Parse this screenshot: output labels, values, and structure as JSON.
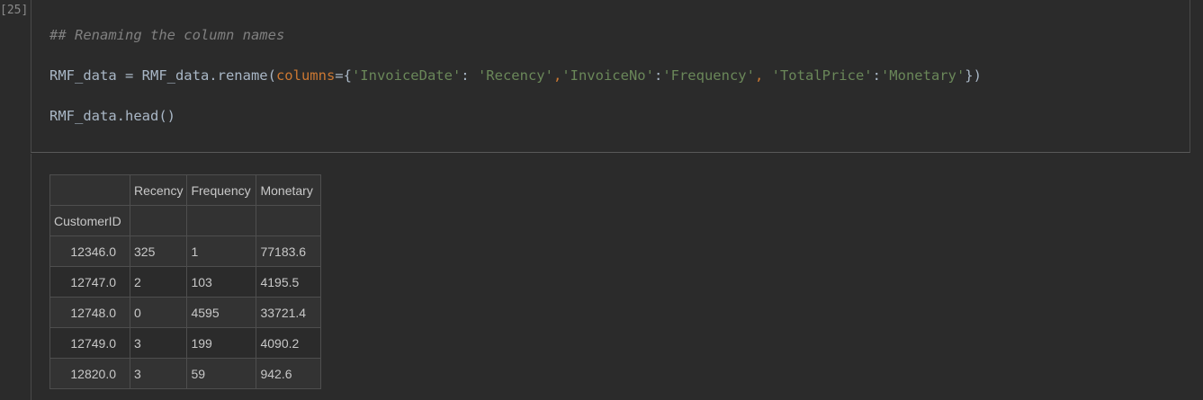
{
  "cell": {
    "execution_count": "[25]",
    "code": {
      "comment": "## Renaming the column names",
      "line2": {
        "lhs": "RMF_data = RMF_data.rename(",
        "kwarg": "columns",
        "eq_brace": "={",
        "k1": "'InvoiceDate'",
        "sep1": ": ",
        "v1": "'Recency'",
        "comma1": ",",
        "k2": "'InvoiceNo'",
        "sep2": ":",
        "v2": "'Frequency'",
        "comma2": ", ",
        "k3": "'TotalPrice'",
        "sep3": ":",
        "v3": "'Monetary'",
        "close": "})"
      },
      "line3": "RMF_data.head()"
    }
  },
  "output": {
    "columns": [
      "Recency",
      "Frequency",
      "Monetary"
    ],
    "index_name": "CustomerID",
    "rows": [
      {
        "index": "12346.0",
        "values": [
          "325",
          "1",
          "77183.6"
        ]
      },
      {
        "index": "12747.0",
        "values": [
          "2",
          "103",
          "4195.5"
        ]
      },
      {
        "index": "12748.0",
        "values": [
          "0",
          "4595",
          "33721.4"
        ]
      },
      {
        "index": "12749.0",
        "values": [
          "3",
          "199",
          "4090.2"
        ]
      },
      {
        "index": "12820.0",
        "values": [
          "3",
          "59",
          "942.6"
        ]
      }
    ]
  }
}
